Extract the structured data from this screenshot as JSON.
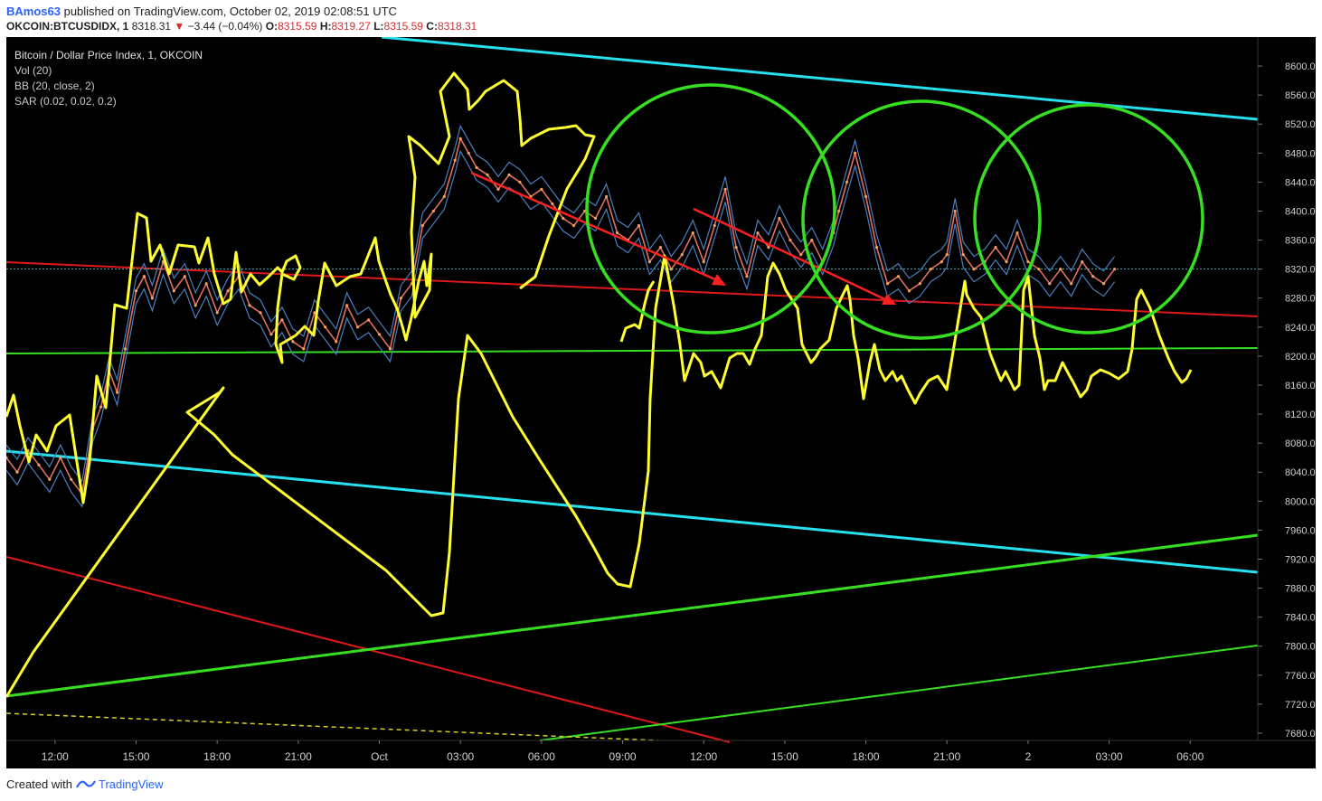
{
  "header": {
    "author": "BAmos63",
    "published": "published on TradingView.com, October 02, 2019 02:08:51 UTC",
    "symbol": "OKCOIN:BTCUSDIDX, 1",
    "last": "8318.31",
    "arrow": "▼",
    "change": "−3.44 (−0.04%)",
    "o_label": "O:",
    "o_value": "8315.59",
    "h_label": "H:",
    "h_value": "8319.27",
    "l_label": "L:",
    "l_value": "8315.59",
    "c_label": "C:",
    "c_value": "8318.31"
  },
  "legend": {
    "title": "Bitcoin / Dollar Price Index, 1, OKCOIN",
    "vol": "Vol (20)",
    "bb": "BB (20, close, 2)",
    "sar": "SAR (0.02, 0.02, 0.2)"
  },
  "footer": {
    "created": "Created with",
    "brand": "TradingView"
  },
  "colors": {
    "background": "#000000",
    "cyan": "#26e0f0",
    "red": "#e01818",
    "green": "#36e020",
    "yellow": "#ffff30",
    "price": "#e07060",
    "bb": "#4a7fc0",
    "last_line": "#39b8c8"
  },
  "chart_data": {
    "type": "line",
    "title": "Bitcoin / Dollar Price Index, 1, OKCOIN",
    "y_ticks": [
      "8600.00",
      "8560.00",
      "8520.00",
      "8480.00",
      "8440.00",
      "8400.00",
      "8360.00",
      "8320.00",
      "8280.00",
      "8240.00",
      "8200.00",
      "8160.00",
      "8120.00",
      "8080.00",
      "8040.00",
      "8000.00",
      "7960.00",
      "7920.00",
      "7880.00",
      "7840.00",
      "7800.00",
      "7760.00",
      "7720.00",
      "7680.00"
    ],
    "ylim": [
      7670,
      8640
    ],
    "x_ticks": [
      "12:00",
      "15:00",
      "18:00",
      "21:00",
      "Oct",
      "03:00",
      "06:00",
      "09:00",
      "12:00",
      "15:00",
      "18:00",
      "21:00",
      "2",
      "03:00",
      "06:00"
    ],
    "x_tick_hours": [
      12,
      15,
      18,
      21,
      24,
      27,
      30,
      33,
      36,
      39,
      42,
      45,
      48,
      51,
      54
    ],
    "xlim_hours": [
      10.2,
      56.5
    ],
    "last_price": 8320.0,
    "series": [
      {
        "hours": [
          10.2,
          10.6,
          11.0,
          11.4,
          11.8,
          12.2,
          12.6,
          13.0,
          13.4,
          13.7,
          14.0,
          14.3,
          14.6,
          15.0,
          15.3,
          15.6,
          16.0,
          16.4,
          16.8,
          17.2,
          17.6,
          18.0,
          18.4,
          18.8,
          19.2,
          19.6,
          20.0,
          20.4,
          20.8,
          21.2,
          21.6,
          22.0,
          22.4,
          22.8,
          23.2,
          23.6,
          24.0,
          24.4,
          24.8,
          25.2,
          25.6,
          26.0,
          26.4,
          26.8,
          27.0,
          27.3,
          27.6,
          28.0,
          28.4,
          28.8,
          29.2,
          29.6,
          30.0,
          30.4,
          30.8,
          31.2,
          31.6,
          32.0,
          32.4,
          32.8,
          33.2,
          33.6,
          34.0,
          34.4,
          34.8,
          35.2,
          35.6,
          36.0,
          36.4,
          36.8,
          37.2,
          37.6,
          38.0,
          38.4,
          38.8,
          39.2,
          39.6,
          40.0,
          40.4,
          40.8,
          41.0,
          41.3,
          41.6,
          42.0,
          42.4,
          42.8,
          43.2,
          43.6,
          44.0,
          44.4,
          44.8,
          45.0,
          45.3,
          45.6,
          46.0,
          46.4,
          46.8,
          47.2,
          47.6,
          48.0,
          48.4,
          48.8,
          49.2,
          49.6,
          50.0,
          50.4,
          50.8,
          51.2
        ],
        "values": [
          8060,
          8040,
          8070,
          8050,
          8030,
          8060,
          8030,
          8010,
          8100,
          8130,
          8180,
          8150,
          8210,
          8290,
          8310,
          8280,
          8330,
          8290,
          8310,
          8270,
          8300,
          8260,
          8290,
          8310,
          8270,
          8260,
          8230,
          8250,
          8220,
          8210,
          8260,
          8240,
          8220,
          8270,
          8240,
          8250,
          8230,
          8210,
          8280,
          8300,
          8380,
          8400,
          8420,
          8470,
          8500,
          8480,
          8460,
          8450,
          8430,
          8450,
          8440,
          8420,
          8430,
          8410,
          8390,
          8380,
          8400,
          8390,
          8420,
          8370,
          8360,
          8380,
          8330,
          8350,
          8320,
          8340,
          8370,
          8330,
          8380,
          8430,
          8350,
          8310,
          8370,
          8350,
          8390,
          8360,
          8340,
          8360,
          8330,
          8370,
          8400,
          8440,
          8480,
          8420,
          8350,
          8300,
          8310,
          8290,
          8300,
          8320,
          8330,
          8340,
          8400,
          8340,
          8320,
          8330,
          8350,
          8330,
          8370,
          8330,
          8320,
          8300,
          8320,
          8300,
          8330,
          8310,
          8300,
          8320
        ]
      }
    ]
  }
}
